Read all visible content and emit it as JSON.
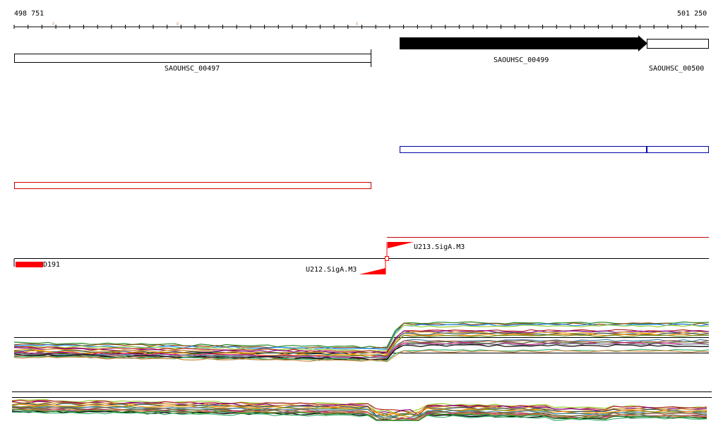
{
  "ruler": {
    "start_label": "498 751",
    "end_label": "501 250"
  },
  "genes": [
    {
      "name": "SAOUHSC_00497",
      "strand": "none"
    },
    {
      "name": "SAOUHSC_00499",
      "strand": "forward"
    },
    {
      "name": "SAOUHSC_00500",
      "strand": "none"
    }
  ],
  "features": [
    {
      "name": "U212.SigA.M3",
      "color": "#ff0000"
    },
    {
      "name": "U213.SigA.M3",
      "color": "#ff0000"
    },
    {
      "name": "D191",
      "color": "#ff0000"
    }
  ],
  "colors": {
    "gene_border": "#000000",
    "gene_fill_forward": "#000000",
    "track_blue": "#0000aa",
    "track_red": "#cc0000",
    "feature_red": "#ff0000",
    "ruler_marker": "#f0d8c8"
  }
}
